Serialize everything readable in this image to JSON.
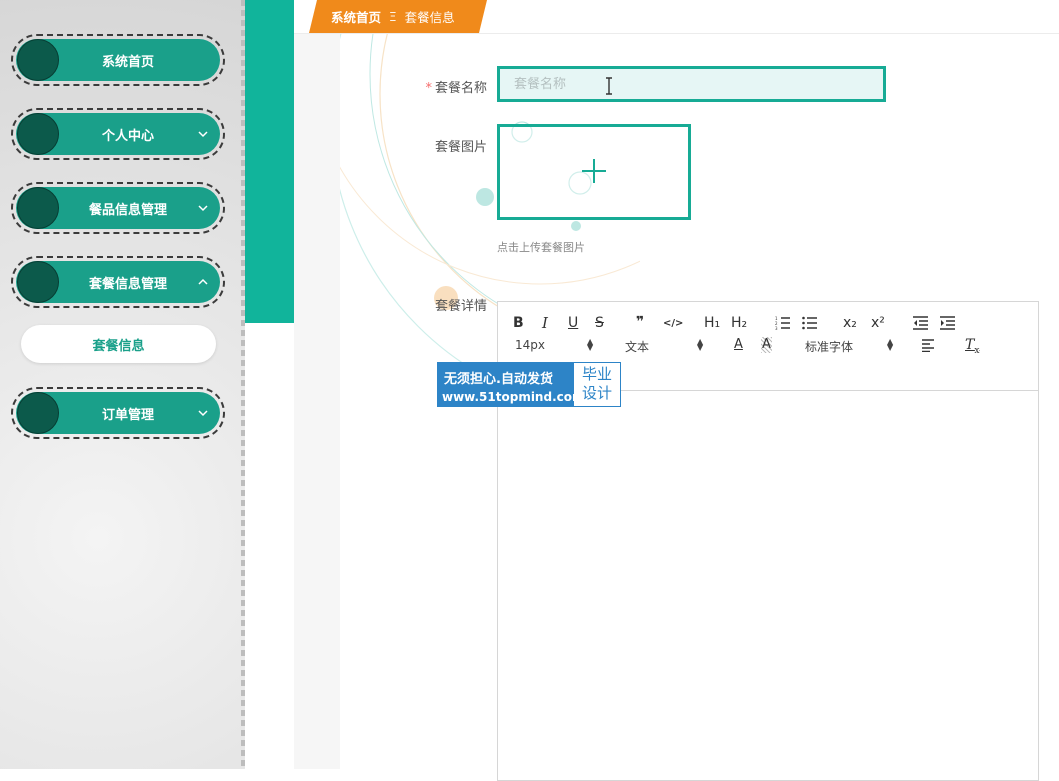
{
  "sidebar": {
    "items": [
      {
        "label": "系统首页",
        "expandable": false
      },
      {
        "label": "个人中心",
        "expandable": true,
        "expanded": false
      },
      {
        "label": "餐品信息管理",
        "expandable": true,
        "expanded": false
      },
      {
        "label": "套餐信息管理",
        "expandable": true,
        "expanded": true
      },
      {
        "label": "订单管理",
        "expandable": true,
        "expanded": false
      }
    ],
    "submenu": {
      "label": "套餐信息"
    }
  },
  "breadcrumb": {
    "home": "系统首页",
    "separator": "Ξ",
    "current": "套餐信息"
  },
  "form": {
    "name": {
      "label": "套餐名称",
      "required_mark": "*",
      "value": "",
      "placeholder": "套餐名称"
    },
    "image": {
      "label": "套餐图片",
      "tip": "点击上传套餐图片"
    },
    "detail": {
      "label": "套餐详情"
    }
  },
  "editor": {
    "toolbar": {
      "bold": "B",
      "italic": "I",
      "underline": "U",
      "strike": "S",
      "quote": "❞",
      "code": "</>",
      "h1": "H₁",
      "h2": "H₂",
      "ordered_list": "ordered-list-icon",
      "bullet_list": "bullet-list-icon",
      "sub": "x₂",
      "sup": "x²",
      "indent_decrease": "indent-decrease-icon",
      "indent_increase": "indent-increase-icon",
      "font_size": "14px",
      "header_select": "文本",
      "font_color": "A",
      "bg_color": "A",
      "font_family": "标准字体",
      "align": "align-icon",
      "clean": "T"
    }
  },
  "watermark": {
    "line1": "无须担心.自动发货",
    "line2": "www.51topmind.com",
    "badge_top": "毕业",
    "badge_bottom": "设计"
  },
  "colors": {
    "teal": "#11b49b",
    "menu_green": "#1aa08a",
    "menu_dot": "#0c5a4b",
    "orange": "#f08a1b",
    "input_border": "#17ab95"
  }
}
